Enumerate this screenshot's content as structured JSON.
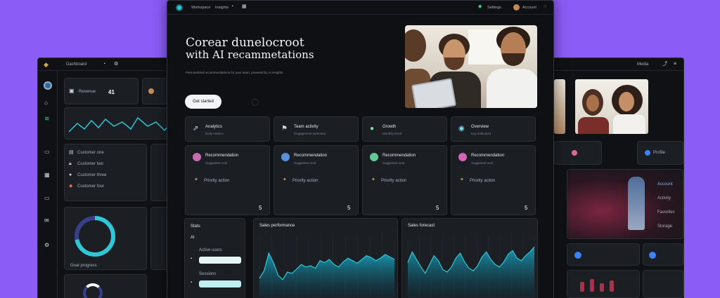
{
  "center": {
    "topbar": {
      "nav_a": "Workspace",
      "nav_b": "Insights",
      "right_a": "Settings",
      "right_b": "Account"
    },
    "hero": {
      "title_line1": "Corear dunelocroot",
      "title_line2": "with AI recammetations",
      "subtitle": "Personalized recommendations for your team, powered by AI insights",
      "cta": "Get started"
    },
    "features": [
      {
        "label": "Analytics",
        "sub": "Daily metrics",
        "icon": "stats-icon"
      },
      {
        "label": "Team activity",
        "sub": "Engagement summary",
        "icon": "people-icon"
      },
      {
        "label": "Growth",
        "sub": "Monthly trend",
        "icon": "leaf-icon"
      },
      {
        "label": "Overview",
        "sub": "Key indicators",
        "icon": "globe-icon"
      }
    ],
    "rec_cards": [
      {
        "title": "Recommendation",
        "sub": "Suggested next",
        "row": "Priority action",
        "value": "5"
      },
      {
        "title": "Recommendation",
        "sub": "Suggested next",
        "row": "Priority action",
        "value": "5"
      },
      {
        "title": "Recommendation",
        "sub": "Suggested next",
        "row": "Priority action",
        "value": "5"
      },
      {
        "title": "Recommendation",
        "sub": "Suggested next",
        "row": "Priority action",
        "value": "5"
      }
    ],
    "side_panel": {
      "title": "Stats",
      "field_a": "Active users",
      "field_b": "Sessions"
    },
    "charts": [
      {
        "title": "Sales performance"
      },
      {
        "title": "Sales forecast"
      }
    ]
  },
  "left": {
    "topbar": {
      "title": "Dashboard"
    },
    "stat": {
      "label": "Revenue",
      "value": "41"
    },
    "list": [
      "Customer one",
      "Customer two",
      "Customer three",
      "Customer four"
    ],
    "donut": {
      "caption": "Goal progress",
      "percent": 0.72
    }
  },
  "right": {
    "topbar": {
      "title": "Media"
    },
    "rows": [
      "Profile",
      "Account",
      "Activity",
      "Favorites",
      "Storage"
    ]
  },
  "colors": {
    "accent": "#2ec7d6",
    "chart": "#1aa3bf",
    "purple": "#8b5cf6",
    "green": "#3ecf8e"
  },
  "chart_data": [
    {
      "type": "area",
      "title": "Sales performance",
      "values": [
        30,
        42,
        70,
        55,
        35,
        28,
        40,
        38,
        45,
        52,
        48,
        50,
        46,
        58,
        55,
        60,
        52,
        48,
        56,
        62,
        58,
        54,
        60,
        66,
        63,
        58,
        62,
        68,
        64,
        60
      ]
    },
    {
      "type": "area",
      "title": "Sales forecast",
      "values": [
        55,
        72,
        60,
        48,
        38,
        52,
        66,
        58,
        44,
        40,
        48,
        62,
        70,
        56,
        46,
        42,
        50,
        64,
        72,
        60,
        52,
        48,
        56,
        68,
        74,
        62,
        58,
        66,
        72,
        80
      ]
    }
  ]
}
